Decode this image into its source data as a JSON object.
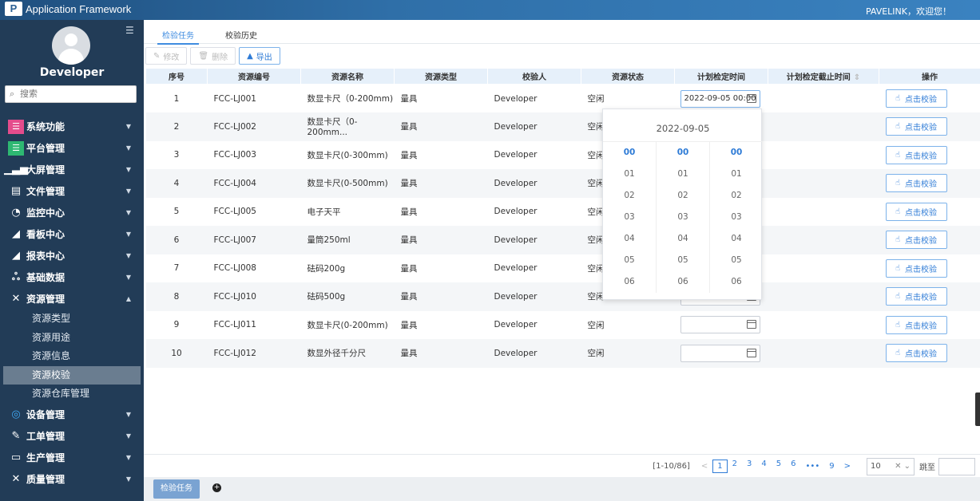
{
  "app": {
    "logo_mark": "P",
    "title": "Application Framework",
    "greeting": "PAVELINK，欢迎您！"
  },
  "sidebar": {
    "username": "Developer",
    "search_placeholder": "搜索",
    "menu": [
      {
        "label": "系统功能",
        "icon": "list-icon",
        "icon_color": "#e44c8c",
        "glyph": "☰"
      },
      {
        "label": "平台管理",
        "icon": "list-icon",
        "icon_color": "#2eb872",
        "glyph": "☰"
      },
      {
        "label": "大屏管理",
        "icon": "bar-chart-icon",
        "icon_color": "#ffffff",
        "glyph": "▁▃▅"
      },
      {
        "label": "文件管理",
        "icon": "document-icon",
        "icon_color": "#ffffff",
        "glyph": "▤"
      },
      {
        "label": "监控中心",
        "icon": "gauge-icon",
        "icon_color": "#ffffff",
        "glyph": "◔"
      },
      {
        "label": "看板中心",
        "icon": "area-chart-icon",
        "icon_color": "#ffffff",
        "glyph": "◢"
      },
      {
        "label": "报表中心",
        "icon": "area-chart-icon",
        "icon_color": "#ffffff",
        "glyph": "◢"
      },
      {
        "label": "基础数据",
        "icon": "nodes-icon",
        "icon_color": "#ffffff",
        "glyph": "ஃ"
      },
      {
        "label": "资源管理",
        "icon": "tools-icon",
        "icon_color": "#ffffff",
        "glyph": "✕",
        "expanded": true
      }
    ],
    "submenu": [
      "资源类型",
      "资源用途",
      "资源信息",
      "资源校验",
      "资源仓库管理"
    ],
    "submenu_active": "资源校验",
    "menu_after": [
      {
        "label": "设备管理",
        "icon": "device-icon",
        "icon_color": "#3fa9f5",
        "glyph": "◎"
      },
      {
        "label": "工单管理",
        "icon": "edit-icon",
        "icon_color": "#ffffff",
        "glyph": "✎"
      },
      {
        "label": "生产管理",
        "icon": "card-icon",
        "icon_color": "#ffffff",
        "glyph": "▭"
      },
      {
        "label": "质量管理",
        "icon": "quality-icon",
        "icon_color": "#ffffff",
        "glyph": "✕"
      }
    ]
  },
  "tabs": {
    "active": "检验任务",
    "other": "校验历史"
  },
  "toolbar": {
    "edit": "修改",
    "delete": "删除",
    "export": "导出"
  },
  "table": {
    "headers": [
      "序号",
      "资源编号",
      "资源名称",
      "资源类型",
      "校验人",
      "资源状态",
      "计划检定时间",
      "计划检定截止时间",
      "操作"
    ],
    "rows": [
      {
        "no": "1",
        "code": "FCC-LJ001",
        "name": "数显卡尺（0-200mm)",
        "type": "量具",
        "checker": "Developer",
        "status": "空闲",
        "plan_time": "2022-09-05 00:00"
      },
      {
        "no": "2",
        "code": "FCC-LJ002",
        "name": "数显卡尺（0-200mm...",
        "type": "量具",
        "checker": "Developer",
        "status": "空闲",
        "plan_time": ""
      },
      {
        "no": "3",
        "code": "FCC-LJ003",
        "name": "数显卡尺(0-300mm)",
        "type": "量具",
        "checker": "Developer",
        "status": "空闲",
        "plan_time": ""
      },
      {
        "no": "4",
        "code": "FCC-LJ004",
        "name": "数显卡尺(0-500mm)",
        "type": "量具",
        "checker": "Developer",
        "status": "空闲",
        "plan_time": ""
      },
      {
        "no": "5",
        "code": "FCC-LJ005",
        "name": "电子天平",
        "type": "量具",
        "checker": "Developer",
        "status": "空闲",
        "plan_time": ""
      },
      {
        "no": "6",
        "code": "FCC-LJ007",
        "name": "量筒250ml",
        "type": "量具",
        "checker": "Developer",
        "status": "空闲",
        "plan_time": ""
      },
      {
        "no": "7",
        "code": "FCC-LJ008",
        "name": "砝码200g",
        "type": "量具",
        "checker": "Developer",
        "status": "空闲",
        "plan_time": ""
      },
      {
        "no": "8",
        "code": "FCC-LJ010",
        "name": "砝码500g",
        "type": "量具",
        "checker": "Developer",
        "status": "空闲",
        "plan_time": ""
      },
      {
        "no": "9",
        "code": "FCC-LJ011",
        "name": "数显卡尺(0-200mm)",
        "type": "量具",
        "checker": "Developer",
        "status": "空闲",
        "plan_time": ""
      },
      {
        "no": "10",
        "code": "FCC-LJ012",
        "name": "数显外径千分尺",
        "type": "量具",
        "checker": "Developer",
        "status": "空闲",
        "plan_time": ""
      }
    ],
    "action_label": "点击校验"
  },
  "picker": {
    "date": "2022-09-05",
    "hours": [
      "00",
      "01",
      "02",
      "03",
      "04",
      "05",
      "06"
    ],
    "minutes": [
      "00",
      "01",
      "02",
      "03",
      "04",
      "05",
      "06"
    ],
    "seconds": [
      "00",
      "01",
      "02",
      "03",
      "04",
      "05",
      "06"
    ]
  },
  "pager": {
    "range": "[1-10/86]",
    "prev": "<",
    "pages": [
      "1",
      "2",
      "3",
      "4",
      "5",
      "6"
    ],
    "current": "1",
    "ellipsis": "•••",
    "last": "9",
    "next": ">",
    "page_size": "10",
    "goto_label": "跳至"
  },
  "bottom": {
    "tab": "检验任务",
    "add": "+"
  }
}
